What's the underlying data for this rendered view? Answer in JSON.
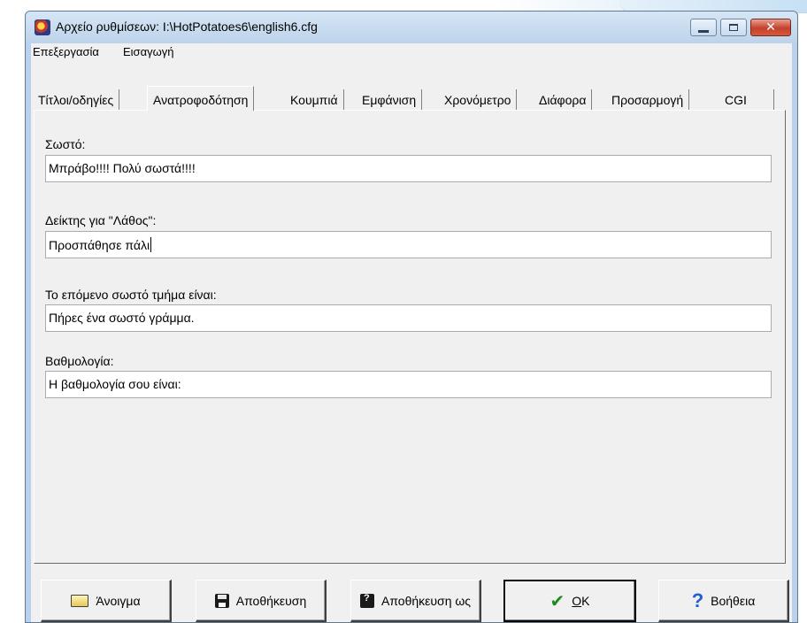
{
  "window": {
    "title": "Αρχείο ρυθμίσεων: I:\\HotPotatoes6\\english6.cfg"
  },
  "menu": [
    "Επεξεργασία",
    "Εισαγωγή"
  ],
  "tabs": [
    "Τίτλοι/οδηγίες",
    "Ανατροφοδότηση",
    "Κουμπιά",
    "Εμφάνιση",
    "Χρονόμετρο",
    "Διάφορα",
    "Προσαρμογή",
    "CGI"
  ],
  "active_tab": "Ανατροφοδότηση",
  "fields": [
    {
      "label": "Σωστό:",
      "value": "Μπράβο!!!! Πολύ σωστά!!!!"
    },
    {
      "label": "Δείκτης για \"Λάθος\":",
      "value": "Προσπάθησε πάλι"
    },
    {
      "label": "Το επόμενο σωστό τμήμα είναι:",
      "value": "Πήρες ένα σωστό γράμμα."
    },
    {
      "label": "Βαθμολογία:",
      "value": "Η βαθμολογία σου είναι:"
    }
  ],
  "buttons": {
    "open": "Άνοιγμα",
    "save": "Αποθήκευση",
    "save_as": "Αποθήκευση ως",
    "ok_accel": "O",
    "ok_rest": "K",
    "help": "Βοήθεια"
  },
  "icons": [
    "folder-icon",
    "floppy-icon",
    "save-as-icon",
    "check-icon",
    "help-icon"
  ],
  "colors": {
    "titlebar": "#bdd3ea",
    "close_button": "#c4412b",
    "ok_check": "#1e8a1e",
    "help": "#1f5fd1"
  }
}
